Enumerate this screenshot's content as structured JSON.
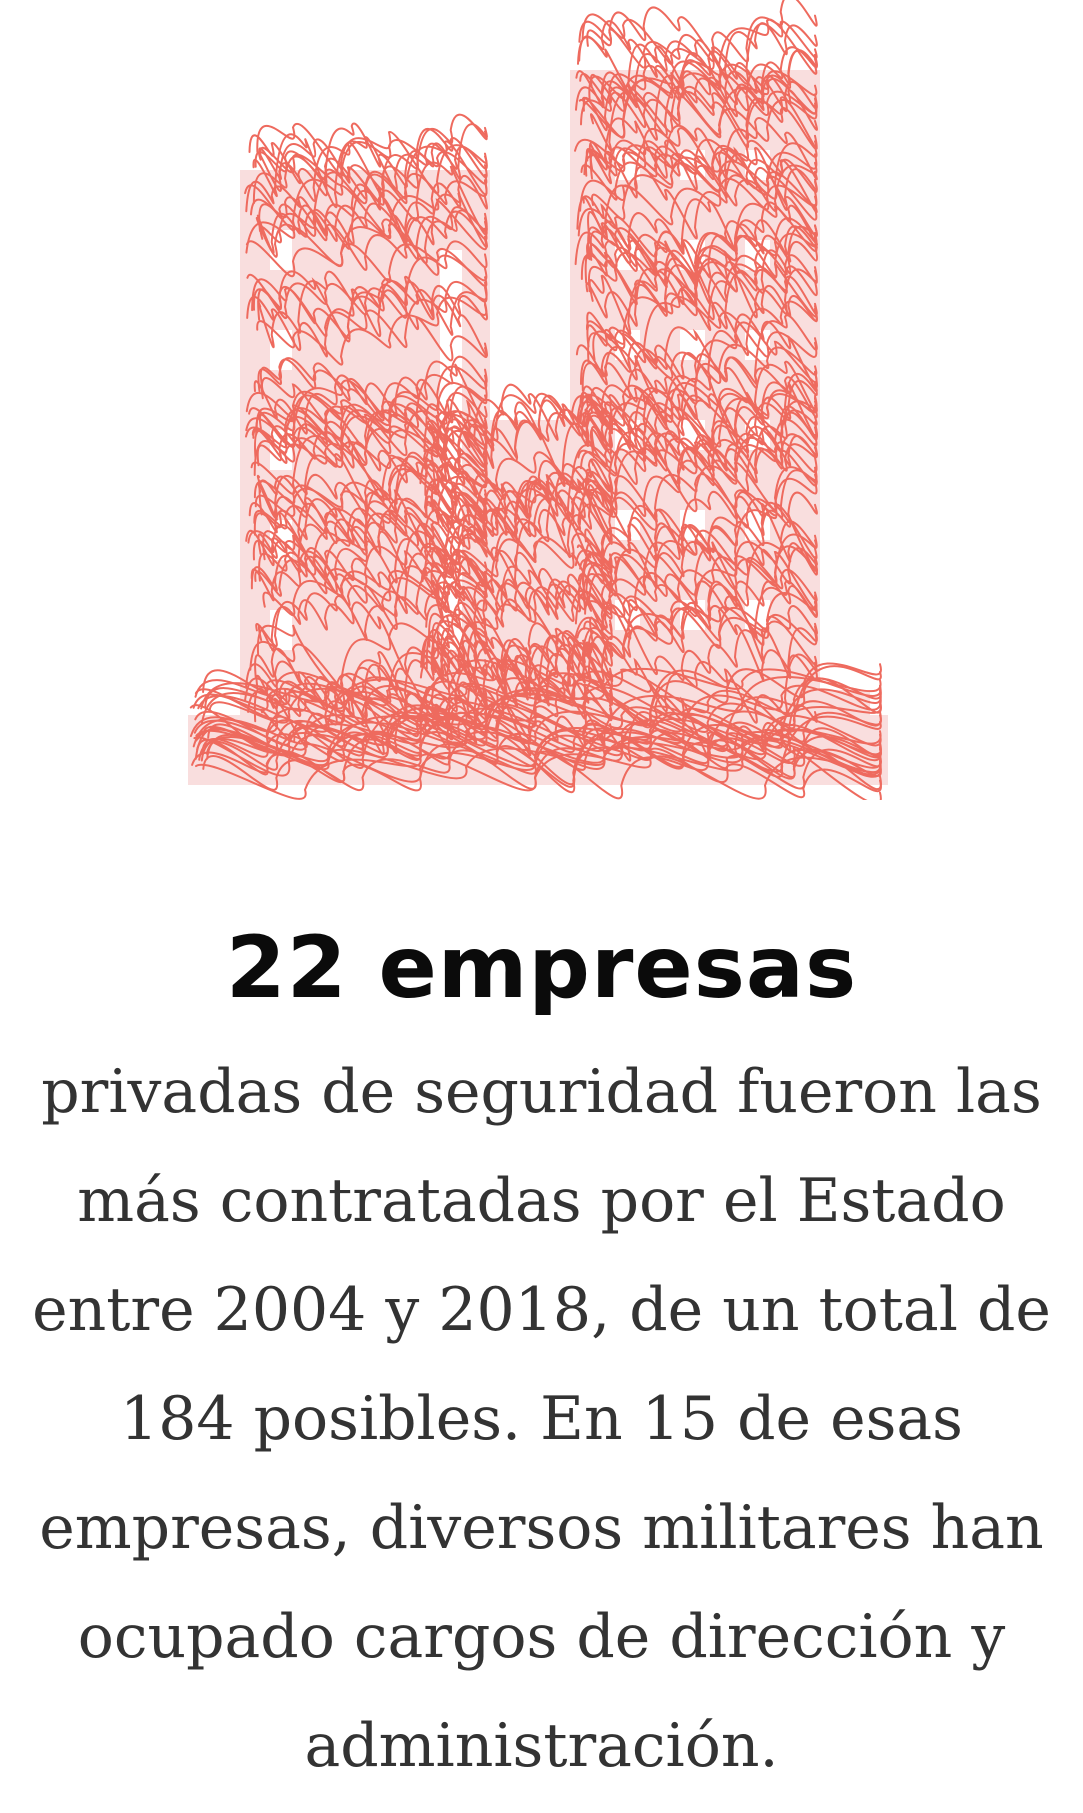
{
  "illustration": {
    "icon": "scribbled-buildings-icon",
    "stroke_color": "#ee6a5e",
    "fill_color": "#f9dede"
  },
  "headline": "22 empresas",
  "body_lines": [
    "privadas de seguridad fueron las",
    "más contratadas por el Estado",
    "entre 2004 y 2018, de un total de",
    "184 posibles. En 15 de esas",
    "empresas, diversos militares han",
    "ocupado cargos de dirección y",
    "administración."
  ]
}
